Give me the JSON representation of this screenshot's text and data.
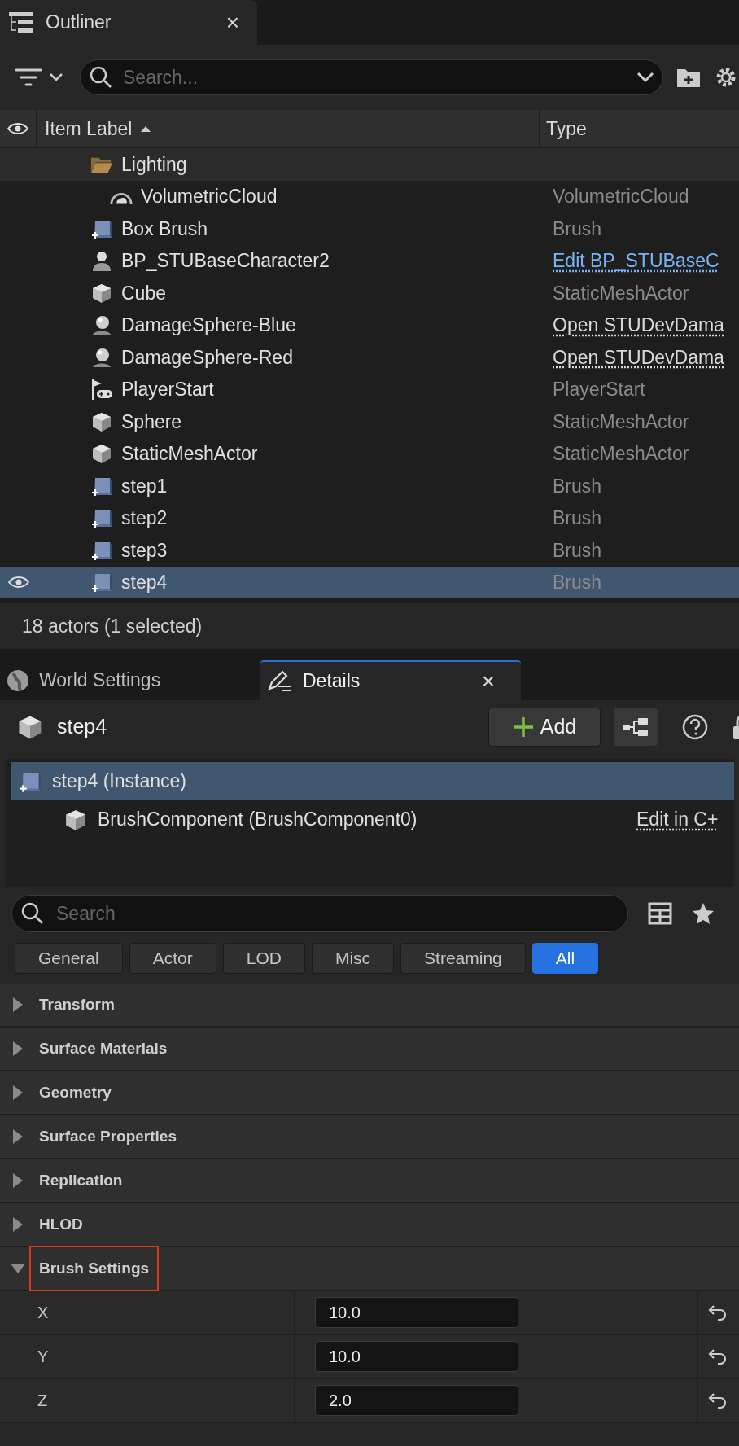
{
  "outliner": {
    "tab": {
      "title": "Outliner",
      "close": "×"
    },
    "search": {
      "placeholder": "Search..."
    },
    "columns": [
      "Item Label",
      "Type"
    ],
    "rows": [
      {
        "label": "Lighting",
        "kind": "folder",
        "selected": false,
        "expanded": true,
        "children": [
          {
            "label": "VolumetricCloud",
            "kind": "cloud",
            "type": {
              "text": "VolumetricCloud",
              "kind": "plain"
            },
            "selected": false
          }
        ]
      },
      {
        "label": "Box Brush",
        "kind": "brush",
        "type": {
          "text": "Brush",
          "kind": "plain"
        },
        "selected": false
      },
      {
        "label": "BP_STUBaseCharacter2",
        "kind": "character",
        "type": {
          "text": "Edit BP_STUBaseC",
          "kind": "accent"
        },
        "selected": false
      },
      {
        "label": "Cube",
        "kind": "mesh",
        "type": {
          "text": "StaticMeshActor",
          "kind": "plain"
        },
        "selected": false
      },
      {
        "label": "DamageSphere-Blue",
        "kind": "sphere",
        "type": {
          "text": "Open STUDevDama",
          "kind": "link"
        },
        "selected": false
      },
      {
        "label": "DamageSphere-Red",
        "kind": "sphere",
        "type": {
          "text": "Open STUDevDama",
          "kind": "link"
        },
        "selected": false
      },
      {
        "label": "PlayerStart",
        "kind": "playerstart",
        "type": {
          "text": "PlayerStart",
          "kind": "plain"
        },
        "selected": false
      },
      {
        "label": "Sphere",
        "kind": "mesh",
        "type": {
          "text": "StaticMeshActor",
          "kind": "plain"
        },
        "selected": false
      },
      {
        "label": "StaticMeshActor",
        "kind": "mesh",
        "type": {
          "text": "StaticMeshActor",
          "kind": "plain"
        },
        "selected": false
      },
      {
        "label": "step1",
        "kind": "brush",
        "type": {
          "text": "Brush",
          "kind": "plain"
        },
        "selected": false
      },
      {
        "label": "step2",
        "kind": "brush",
        "type": {
          "text": "Brush",
          "kind": "plain"
        },
        "selected": false
      },
      {
        "label": "step3",
        "kind": "brush",
        "type": {
          "text": "Brush",
          "kind": "plain"
        },
        "selected": false
      },
      {
        "label": "step4",
        "kind": "brush",
        "type": {
          "text": "Brush",
          "kind": "plain"
        },
        "selected": true
      }
    ],
    "status": "18 actors (1 selected)"
  },
  "details": {
    "tabs": [
      {
        "label": "World Settings",
        "selected": false
      },
      {
        "label": "Details",
        "selected": true,
        "close": "×"
      }
    ],
    "actor_name": "step4",
    "add_button": "Add",
    "components": [
      {
        "label": "step4 (Instance)",
        "kind": "brush",
        "selected": true,
        "children": [
          {
            "label": "BrushComponent (BrushComponent0)",
            "kind": "mesh",
            "selected": false,
            "link": "Edit in C+"
          }
        ]
      }
    ],
    "search": {
      "placeholder": "Search"
    },
    "filters": [
      {
        "label": "General",
        "selected": false
      },
      {
        "label": "Actor",
        "selected": false
      },
      {
        "label": "LOD",
        "selected": false
      },
      {
        "label": "Misc",
        "selected": false
      },
      {
        "label": "Streaming",
        "selected": false
      },
      {
        "label": "All",
        "selected": true
      }
    ],
    "categories": [
      {
        "label": "Transform",
        "expanded": false,
        "highlighted": false
      },
      {
        "label": "Surface Materials",
        "expanded": false,
        "highlighted": false
      },
      {
        "label": "Geometry",
        "expanded": false,
        "highlighted": false
      },
      {
        "label": "Surface Properties",
        "expanded": false,
        "highlighted": false
      },
      {
        "label": "Replication",
        "expanded": false,
        "highlighted": false
      },
      {
        "label": "HLOD",
        "expanded": false,
        "highlighted": false
      },
      {
        "label": "Brush Settings",
        "expanded": true,
        "highlighted": true,
        "properties": [
          {
            "label": "X",
            "value": "10.0"
          },
          {
            "label": "Y",
            "value": "10.0"
          },
          {
            "label": "Z",
            "value": "2.0"
          }
        ]
      }
    ]
  }
}
